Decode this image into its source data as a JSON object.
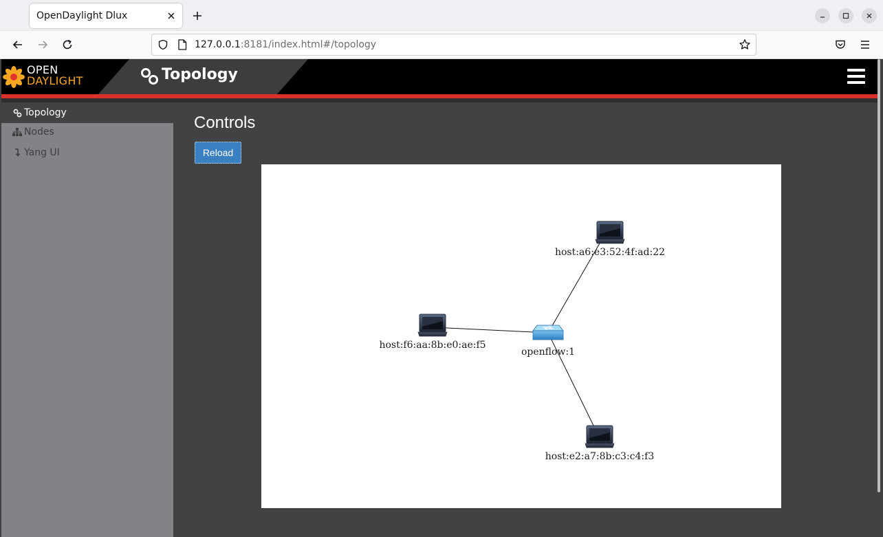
{
  "browser": {
    "tab_title": "OpenDaylight Dlux",
    "url_host": "127.0.0.1",
    "url_rest": ":8181/index.html#/topology"
  },
  "app": {
    "logo_line1": "OPEN",
    "logo_line2": "DAYLIGHT",
    "page_title": "Topology"
  },
  "sidebar": {
    "items": [
      {
        "label": "Topology",
        "icon": "link-icon",
        "active": true
      },
      {
        "label": "Nodes",
        "icon": "sitemap-icon",
        "active": false
      },
      {
        "label": "Yang UI",
        "icon": "arrow-down-icon",
        "active": false
      }
    ]
  },
  "controls": {
    "title": "Controls",
    "reload_label": "Reload"
  },
  "topology": {
    "nodes": [
      {
        "id": "host:a6:e3:52:4f:ad:22",
        "type": "host"
      },
      {
        "id": "host:f6:aa:8b:e0:ae:f5",
        "type": "host"
      },
      {
        "id": "openflow:1",
        "type": "switch"
      },
      {
        "id": "host:e2:a7:8b:c3:c4:f3",
        "type": "host"
      }
    ],
    "links": [
      {
        "source": "openflow:1",
        "target": "host:a6:e3:52:4f:ad:22"
      },
      {
        "source": "openflow:1",
        "target": "host:f6:aa:8b:e0:ae:f5"
      },
      {
        "source": "openflow:1",
        "target": "host:e2:a7:8b:c3:c4:f3"
      }
    ]
  },
  "colors": {
    "header_red": "#d9302a",
    "button_blue": "#3a7fc2",
    "logo_orange": "#f7a622"
  }
}
